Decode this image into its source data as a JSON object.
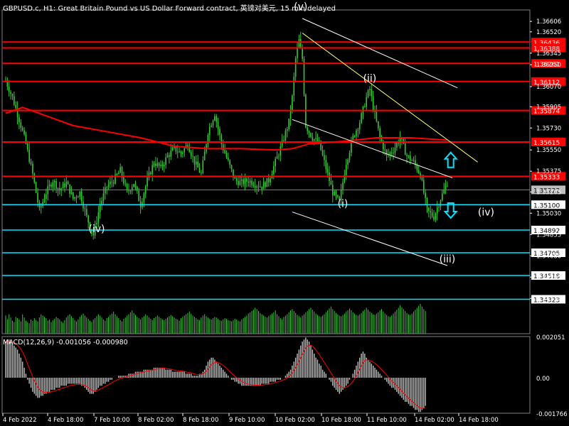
{
  "header": {
    "title": "GBPUSD.c, H1:  Great Britain Pound vs US Dollar Forward contract, 英镑对美元, 15 min delayed"
  },
  "macd": {
    "label": "MACD(12,26,9) -0.001056 -0.000980"
  },
  "colors": {
    "background": "#000000",
    "grid": "#ffffff",
    "candle": "#33cc33",
    "resistance": "#ff0000",
    "support": "#00e5ff",
    "ma": "#ff0000",
    "channel": "#ffffff",
    "trendline": "#ffff66",
    "arrow": "#00e5ff",
    "volume": "#33cc33",
    "macd_hist": "#c0c0c0",
    "macd_signal": "#ff0000"
  },
  "chart_data": {
    "type": "candlestick",
    "symbol": "GBPUSD.c",
    "timeframe": "H1",
    "ylim": [
      1.3404,
      1.367
    ],
    "y_ticks": [
      "1.36606",
      "1.36520",
      "1.36345",
      "1.36250",
      "1.36070",
      "1.35905",
      "1.35730",
      "1.35550",
      "1.35375",
      "1.35205",
      "1.35030",
      "1.34855",
      "1.34680",
      "1.34505",
      "1.34330"
    ],
    "x_ticks": [
      "4 Feb 2022",
      "4 Feb 18:00",
      "7 Feb 10:00",
      "8 Feb 02:00",
      "8 Feb 18:00",
      "9 Feb 10:00",
      "10 Feb 02:00",
      "10 Feb 18:00",
      "11 Feb 10:00",
      "14 Feb 02:00",
      "14 Feb 18:00"
    ],
    "close_path": [
      [
        0,
        1.3612
      ],
      [
        4,
        1.3598
      ],
      [
        8,
        1.358
      ],
      [
        12,
        1.356
      ],
      [
        16,
        1.3535
      ],
      [
        20,
        1.3505
      ],
      [
        24,
        1.352
      ],
      [
        28,
        1.353
      ],
      [
        32,
        1.3522
      ],
      [
        36,
        1.3528
      ],
      [
        40,
        1.3515
      ],
      [
        44,
        1.352
      ],
      [
        48,
        1.35
      ],
      [
        52,
        1.3485
      ],
      [
        56,
        1.351
      ],
      [
        60,
        1.3525
      ],
      [
        64,
        1.353
      ],
      [
        68,
        1.3538
      ],
      [
        72,
        1.352
      ],
      [
        76,
        1.3528
      ],
      [
        80,
        1.351
      ],
      [
        84,
        1.353
      ],
      [
        88,
        1.3545
      ],
      [
        92,
        1.354
      ],
      [
        96,
        1.355
      ],
      [
        100,
        1.3556
      ],
      [
        104,
        1.3552
      ],
      [
        108,
        1.356
      ],
      [
        112,
        1.3545
      ],
      [
        116,
        1.3535
      ],
      [
        120,
        1.357
      ],
      [
        124,
        1.3585
      ],
      [
        128,
        1.356
      ],
      [
        132,
        1.3545
      ],
      [
        136,
        1.353
      ],
      [
        140,
        1.3528
      ],
      [
        144,
        1.353
      ],
      [
        148,
        1.3527
      ],
      [
        152,
        1.3525
      ],
      [
        156,
        1.353
      ],
      [
        160,
        1.3545
      ],
      [
        164,
        1.356
      ],
      [
        168,
        1.3578
      ],
      [
        170,
        1.3598
      ],
      [
        172,
        1.363
      ],
      [
        174,
        1.3645
      ],
      [
        176,
        1.363
      ],
      [
        178,
        1.3575
      ],
      [
        182,
        1.3565
      ],
      [
        186,
        1.356
      ],
      [
        190,
        1.354
      ],
      [
        194,
        1.352
      ],
      [
        198,
        1.3512
      ],
      [
        202,
        1.3545
      ],
      [
        206,
        1.3565
      ],
      [
        210,
        1.3578
      ],
      [
        214,
        1.3598
      ],
      [
        216,
        1.3605
      ],
      [
        218,
        1.359
      ],
      [
        222,
        1.3565
      ],
      [
        226,
        1.355
      ],
      [
        230,
        1.3555
      ],
      [
        234,
        1.3565
      ],
      [
        238,
        1.355
      ],
      [
        242,
        1.3545
      ],
      [
        246,
        1.3535
      ],
      [
        250,
        1.3505
      ],
      [
        254,
        1.35
      ],
      [
        258,
        1.3515
      ],
      [
        262,
        1.3528
      ]
    ],
    "candle_count": 263,
    "moving_average": [
      [
        0,
        1.3585
      ],
      [
        10,
        1.359
      ],
      [
        20,
        1.3585
      ],
      [
        40,
        1.3575
      ],
      [
        60,
        1.357
      ],
      [
        80,
        1.3565
      ],
      [
        100,
        1.3558
      ],
      [
        120,
        1.3556
      ],
      [
        140,
        1.3556
      ],
      [
        160,
        1.3555
      ],
      [
        170,
        1.3556
      ],
      [
        180,
        1.356
      ],
      [
        200,
        1.3562
      ],
      [
        220,
        1.3565
      ],
      [
        240,
        1.3565
      ],
      [
        262,
        1.3563
      ]
    ],
    "resistance_levels": [
      {
        "label": "1.36436",
        "value": 1.36436
      },
      {
        "label": "1.36388",
        "value": 1.36388
      },
      {
        "label": "1.36261",
        "value": 1.36261
      },
      {
        "label": "1.36112",
        "value": 1.36112
      },
      {
        "label": "1.35874",
        "value": 1.35874
      },
      {
        "label": "1.35615",
        "value": 1.35615
      },
      {
        "label": "1.35333",
        "value": 1.35333
      }
    ],
    "support_levels": [
      {
        "label": "1.35100",
        "value": 1.351
      },
      {
        "label": "1.34892",
        "value": 1.34892
      },
      {
        "label": "1.34705",
        "value": 1.34705
      },
      {
        "label": "1.34518",
        "value": 1.34518
      },
      {
        "label": "1.34323",
        "value": 1.34323
      }
    ],
    "current_price": "1.35222",
    "wave_labels": [
      {
        "text": "(iv)",
        "bar": 54,
        "price": 1.34875
      },
      {
        "text": "(v)",
        "bar": 175,
        "price": 1.367
      },
      {
        "text": "(i)",
        "bar": 200,
        "price": 1.3508
      },
      {
        "text": "(ii)",
        "bar": 216,
        "price": 1.3611
      },
      {
        "text": "(iii)",
        "bar": 262,
        "price": 1.34625
      },
      {
        "text": "(iv)",
        "bar": 285,
        "price": 1.3501
      }
    ],
    "channel_lines": [
      [
        [
          176,
          1.3663
        ],
        [
          268,
          1.3606
        ]
      ],
      [
        [
          170,
          1.358
        ],
        [
          265,
          1.3532
        ]
      ],
      [
        [
          170,
          1.3504
        ],
        [
          262,
          1.346
        ]
      ]
    ],
    "trend_lines": [
      [
        [
          176,
          1.3651
        ],
        [
          280,
          1.3545
        ]
      ]
    ],
    "arrows": [
      {
        "dir": "up",
        "bar": 264,
        "price": 1.35465
      },
      {
        "dir": "down",
        "bar": 264,
        "price": 1.35055
      }
    ],
    "volume": [
      28,
      22,
      30,
      25,
      20,
      18,
      26,
      24,
      22,
      19,
      30,
      25,
      20,
      18,
      16,
      22,
      20,
      24,
      21,
      19,
      25,
      30,
      28,
      26,
      24,
      20,
      22,
      18,
      21,
      23,
      26,
      24,
      22,
      19,
      17,
      21,
      25,
      28,
      30,
      27,
      24,
      21,
      19,
      22,
      26,
      29,
      31,
      28,
      25,
      23,
      20,
      18,
      22,
      24,
      27,
      30,
      28,
      25,
      22,
      20,
      24,
      26,
      29,
      31,
      34,
      30,
      27,
      24,
      21,
      19,
      23,
      25,
      28,
      30,
      33,
      36,
      32,
      29,
      26,
      24,
      22,
      25,
      27,
      30,
      28,
      25,
      23,
      21,
      24,
      26,
      28,
      26,
      24,
      22,
      21,
      23,
      25,
      27,
      29,
      27,
      25,
      23,
      22,
      20,
      24,
      26,
      28,
      30,
      32,
      34,
      31,
      28,
      26,
      24,
      22,
      21,
      25,
      28,
      30,
      27,
      25,
      23,
      22,
      24,
      26,
      25,
      23,
      21,
      20,
      22,
      24,
      23,
      21,
      20,
      19,
      21,
      23,
      22,
      20,
      19,
      22,
      24,
      26,
      28,
      31,
      33,
      35,
      37,
      40,
      38,
      35,
      32,
      30,
      28,
      26,
      25,
      27,
      29,
      31,
      33,
      36,
      30,
      27,
      24,
      22,
      26,
      28,
      30,
      33,
      36,
      38,
      35,
      32,
      29,
      27,
      25,
      28,
      30,
      33,
      35,
      38,
      40,
      37,
      34,
      31,
      29,
      27,
      26,
      28,
      30,
      33,
      36,
      39,
      42,
      38,
      35,
      32,
      30,
      28,
      27,
      29,
      31,
      34,
      36,
      39,
      36,
      33,
      31,
      29,
      28,
      30,
      32,
      35,
      37,
      40,
      37,
      34,
      32,
      30,
      29,
      31,
      33,
      36,
      38,
      34,
      31,
      29,
      27,
      26,
      28,
      31,
      34,
      37,
      40,
      44,
      41,
      38,
      35,
      32,
      30,
      29,
      31,
      34,
      37,
      40,
      43,
      46,
      42,
      38,
      35
    ],
    "macd_hist": [
      0.0018,
      0.0019,
      0.0019,
      0.0018,
      0.0017,
      0.0016,
      0.0015,
      0.0014,
      0.0012,
      0.001,
      0.0008,
      0.0005,
      0.0002,
      -0.0001,
      -0.0003,
      -0.0005,
      -0.0007,
      -0.0008,
      -0.0009,
      -0.001,
      -0.001,
      -0.0009,
      -0.0009,
      -0.0008,
      -0.0008,
      -0.0007,
      -0.0007,
      -0.0006,
      -0.0006,
      -0.0006,
      -0.0005,
      -0.0005,
      -0.0005,
      -0.0004,
      -0.0004,
      -0.0004,
      -0.0004,
      -0.0003,
      -0.0003,
      -0.0003,
      -0.0003,
      -0.0003,
      -0.0003,
      -0.0003,
      -0.0003,
      -0.0004,
      -0.0004,
      -0.0005,
      -0.0006,
      -0.0007,
      -0.0008,
      -0.0008,
      -0.0008,
      -0.0007,
      -0.0006,
      -0.0005,
      -0.0004,
      -0.0004,
      -0.0003,
      -0.0003,
      -0.0002,
      -0.0002,
      -0.0001,
      -0.0001,
      0.0,
      0.0,
      0.0,
      0.0001,
      0.0001,
      0.0001,
      0.0001,
      0.0001,
      0.0001,
      0.0002,
      0.0002,
      0.0002,
      0.0002,
      0.0003,
      0.0003,
      0.0003,
      0.0003,
      0.0003,
      0.0004,
      0.0004,
      0.0004,
      0.0004,
      0.0004,
      0.0004,
      0.0005,
      0.0005,
      0.0005,
      0.0005,
      0.0005,
      0.0005,
      0.0005,
      0.0004,
      0.0004,
      0.0004,
      0.0004,
      0.0003,
      0.0003,
      0.0003,
      0.0003,
      0.0003,
      0.0003,
      0.0003,
      0.0003,
      0.0002,
      0.0002,
      0.0002,
      0.0002,
      0.0001,
      0.0001,
      0.0001,
      0.0001,
      0.0002,
      0.0002,
      0.0003,
      0.0004,
      0.0006,
      0.0008,
      0.0009,
      0.001,
      0.001,
      0.0009,
      0.0008,
      0.0007,
      0.0006,
      0.0005,
      0.0004,
      0.0003,
      0.0002,
      0.0001,
      0.0,
      -0.0001,
      -0.0001,
      -0.0002,
      -0.0002,
      -0.0003,
      -0.0003,
      -0.0004,
      -0.0004,
      -0.0004,
      -0.0004,
      -0.0004,
      -0.0004,
      -0.0004,
      -0.0004,
      -0.0004,
      -0.0004,
      -0.0004,
      -0.0004,
      -0.0003,
      -0.0003,
      -0.0003,
      -0.0003,
      -0.0003,
      -0.0002,
      -0.0002,
      -0.0002,
      -0.0002,
      -0.0001,
      -0.0001,
      -0.0001,
      0.0,
      0.0,
      0.0001,
      0.0002,
      0.0003,
      0.0004,
      0.0006,
      0.0008,
      0.001,
      0.0012,
      0.0014,
      0.0016,
      0.0018,
      0.0019,
      0.002,
      0.0019,
      0.0018,
      0.0016,
      0.0014,
      0.0012,
      0.001,
      0.0009,
      0.0007,
      0.0006,
      0.0004,
      0.0003,
      0.0002,
      0.0,
      -0.0001,
      -0.0002,
      -0.0004,
      -0.0005,
      -0.0006,
      -0.0007,
      -0.0008,
      -0.0007,
      -0.0006,
      -0.0005,
      -0.0004,
      -0.0003,
      -0.0001,
      0.0,
      0.0002,
      0.0004,
      0.0006,
      0.0008,
      0.001,
      0.0012,
      0.0013,
      0.0012,
      0.001,
      0.0009,
      0.0008,
      0.0007,
      0.0006,
      0.0005,
      0.0004,
      0.0003,
      0.0002,
      0.0001,
      0.0,
      -0.0001,
      -0.0002,
      -0.0003,
      -0.0004,
      -0.0005,
      -0.0005,
      -0.0006,
      -0.0007,
      -0.0008,
      -0.0009,
      -0.001,
      -0.0011,
      -0.0012,
      -0.0012,
      -0.0013,
      -0.0014,
      -0.0014,
      -0.0015,
      -0.0016,
      -0.0016,
      -0.0017,
      -0.0017,
      -0.0016,
      -0.0015,
      -0.0014
    ],
    "macd_ylim": [
      -0.001766,
      0.00205
    ],
    "macd_ticks": [
      "0.002051",
      "0.00",
      "-0.001766"
    ],
    "grid": false
  }
}
